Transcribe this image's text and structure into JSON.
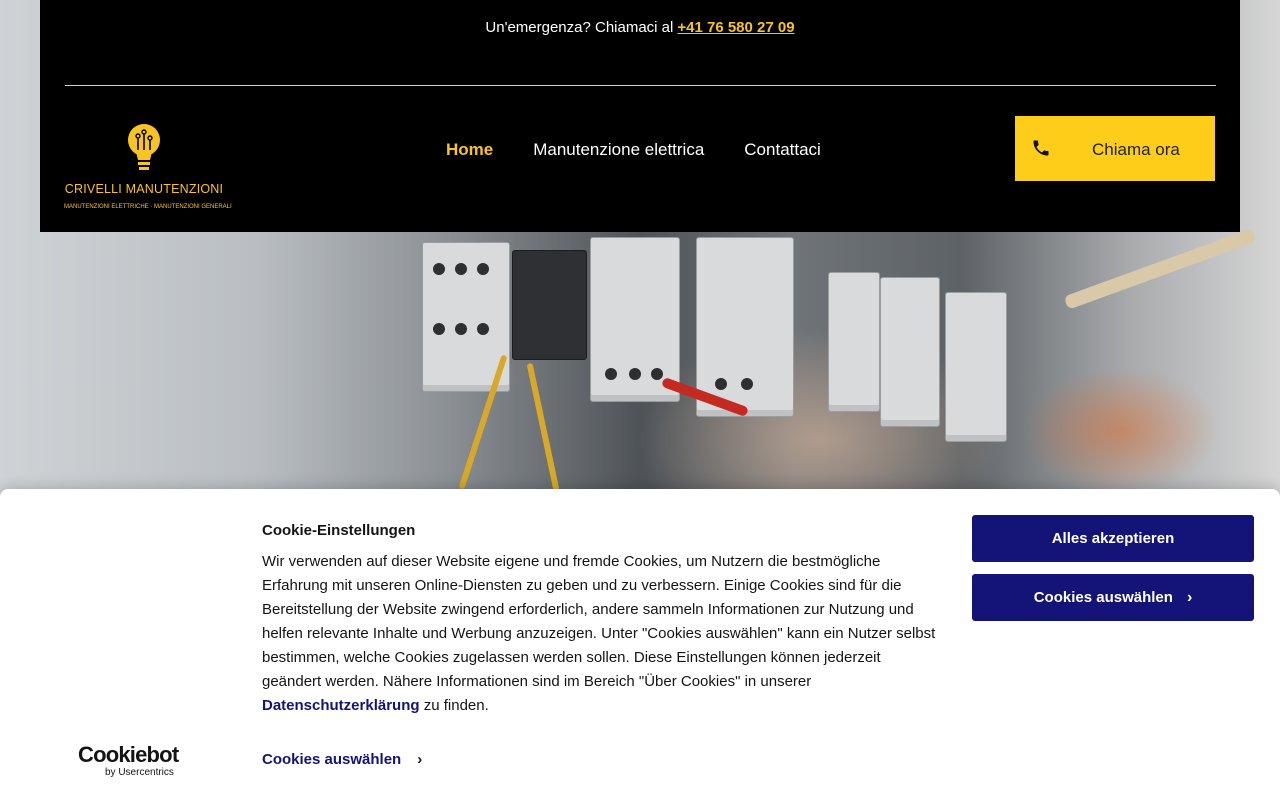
{
  "topbar": {
    "emergency_text": "Un'emergenza? Chiamaci al",
    "phone": "+41 76 580 27 09"
  },
  "logo": {
    "name": "CRIVELLI MANUTENZIONI",
    "tagline": "MANUTENZIONI ELETTRICHE · MANUTENZIONI GENERALI",
    "icon": "lightbulb-circuit-icon"
  },
  "nav": {
    "items": [
      {
        "label": "Home",
        "active": true
      },
      {
        "label": "Manutenzione elettrica",
        "active": false
      },
      {
        "label": "Contattaci",
        "active": false
      }
    ]
  },
  "cta": {
    "label": "Chiama ora",
    "icon": "phone-icon"
  },
  "cookie_banner": {
    "title": "Cookie-Einstellungen",
    "body": "Wir verwenden auf dieser Website eigene und fremde Cookies, um Nutzern die bestmögliche Erfahrung mit unseren Online-Diensten zu geben und zu verbessern. Einige Cookies sind für die Bereitstellung der Website zwingend erforderlich, andere sammeln Informationen zur Nutzung und helfen relevante Inhalte und Werbung anzuzeigen. Unter \"Cookies auswählen\" kann ein Nutzer selbst bestimmen, welche Cookies zugelassen werden sollen. Diese Einstellungen können jederzeit geändert werden. Nähere Informationen sind im Bereich \"Über Cookies\" in unserer",
    "privacy_link": "Datenschutzerklärung",
    "body_end": "zu finden.",
    "accept_label": "Alles akzeptieren",
    "select_label": "Cookies auswählen",
    "bottom_link": "Cookies auswählen",
    "brand": "Cookiebot",
    "brand_sub": "by Usercentrics"
  },
  "colors": {
    "accent_yellow": "#f9c423",
    "cta_yellow": "#fecd1a",
    "cookie_blue": "#141478",
    "header_bg": "#000000"
  }
}
